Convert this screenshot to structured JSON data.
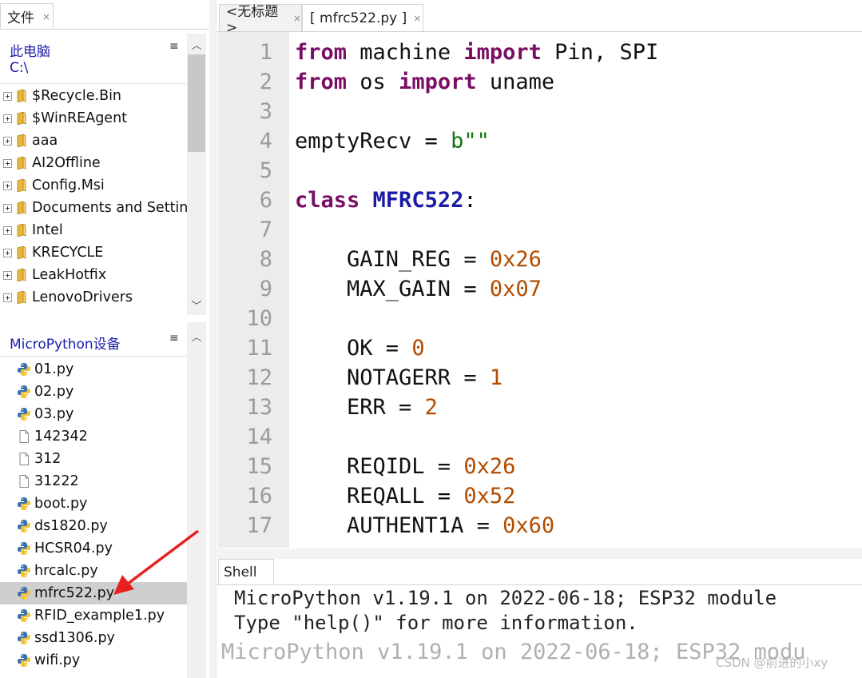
{
  "files_panel": {
    "tab_label": "文件",
    "tab_close": "×",
    "computer": {
      "title": "此电脑",
      "path": "C:\\",
      "menu": "≡",
      "folders": [
        "$Recycle.Bin",
        "$WinREAgent",
        "aaa",
        "AI2Offline",
        "Config.Msi",
        "Documents and Settin",
        "Intel",
        "KRECYCLE",
        "LeakHotfix",
        "LenovoDrivers"
      ]
    },
    "device": {
      "title": "MicroPython设备",
      "menu": "≡",
      "files": [
        {
          "name": "01.py",
          "icon": "python-file-icon"
        },
        {
          "name": "02.py",
          "icon": "python-file-icon"
        },
        {
          "name": "03.py",
          "icon": "python-file-icon"
        },
        {
          "name": "142342",
          "icon": "plain-file-icon"
        },
        {
          "name": "312",
          "icon": "plain-file-icon"
        },
        {
          "name": "31222",
          "icon": "plain-file-icon"
        },
        {
          "name": "boot.py",
          "icon": "python-file-icon"
        },
        {
          "name": "ds1820.py",
          "icon": "python-file-icon"
        },
        {
          "name": "HCSR04.py",
          "icon": "python-file-icon"
        },
        {
          "name": "hrcalc.py",
          "icon": "python-file-icon"
        },
        {
          "name": "mfrc522.py",
          "icon": "python-file-icon",
          "selected": true
        },
        {
          "name": "RFID_example1.py",
          "icon": "python-file-icon"
        },
        {
          "name": "ssd1306.py",
          "icon": "python-file-icon"
        },
        {
          "name": "wifi.py",
          "icon": "python-file-icon"
        }
      ]
    }
  },
  "editor": {
    "tabs": [
      {
        "label": "<无标题>",
        "close": "×"
      },
      {
        "label": "[ mfrc522.py ]",
        "close": "×",
        "active": true
      }
    ],
    "lines": [
      {
        "n": "1",
        "tokens": [
          [
            "kw",
            "from"
          ],
          [
            "",
            "machine"
          ],
          [
            "kw",
            "import"
          ],
          [
            "",
            "Pin, SPI"
          ]
        ]
      },
      {
        "n": "2",
        "tokens": [
          [
            "kw",
            "from"
          ],
          [
            "",
            "os"
          ],
          [
            "kw",
            "import"
          ],
          [
            "",
            "uname"
          ]
        ]
      },
      {
        "n": "3",
        "tokens": []
      },
      {
        "n": "4",
        "tokens": [
          [
            "",
            "emptyRecv = "
          ],
          [
            "str",
            "b\"\""
          ]
        ]
      },
      {
        "n": "5",
        "tokens": []
      },
      {
        "n": "6",
        "tokens": [
          [
            "kw",
            "class"
          ],
          [
            "cls",
            "MFRC522"
          ],
          [
            "",
            ":"
          ]
        ]
      },
      {
        "n": "7",
        "tokens": []
      },
      {
        "n": "8",
        "tokens": [
          [
            "",
            "    GAIN_REG = "
          ],
          [
            "num",
            "0x26"
          ]
        ]
      },
      {
        "n": "9",
        "tokens": [
          [
            "",
            "    MAX_GAIN = "
          ],
          [
            "num",
            "0x07"
          ]
        ]
      },
      {
        "n": "10",
        "tokens": []
      },
      {
        "n": "11",
        "tokens": [
          [
            "",
            "    OK = "
          ],
          [
            "num",
            "0"
          ]
        ]
      },
      {
        "n": "12",
        "tokens": [
          [
            "",
            "    NOTAGERR = "
          ],
          [
            "num",
            "1"
          ]
        ]
      },
      {
        "n": "13",
        "tokens": [
          [
            "",
            "    ERR = "
          ],
          [
            "num",
            "2"
          ]
        ]
      },
      {
        "n": "14",
        "tokens": []
      },
      {
        "n": "15",
        "tokens": [
          [
            "",
            "    REQIDL = "
          ],
          [
            "num",
            "0x26"
          ]
        ]
      },
      {
        "n": "16",
        "tokens": [
          [
            "",
            "    REQALL = "
          ],
          [
            "num",
            "0x52"
          ]
        ]
      },
      {
        "n": "17",
        "tokens": [
          [
            "",
            "    AUTHENT1A = "
          ],
          [
            "num",
            "0x60"
          ]
        ]
      }
    ]
  },
  "shell": {
    "tab_label": "Shell",
    "line1": "MicroPython v1.19.1 on 2022-06-18; ESP32 module",
    "line2": "Type \"help()\" for more information.",
    "echo": "MicroPython v1.19.1 on 2022-06-18; ESP32 modu"
  },
  "watermark": "CSDN @前进的小xy",
  "colors": {
    "keyword": "#7a0e64",
    "class_name": "#1b1ba6",
    "number": "#b24c00",
    "string": "#127312",
    "annotation_arrow": "#e8201f"
  }
}
